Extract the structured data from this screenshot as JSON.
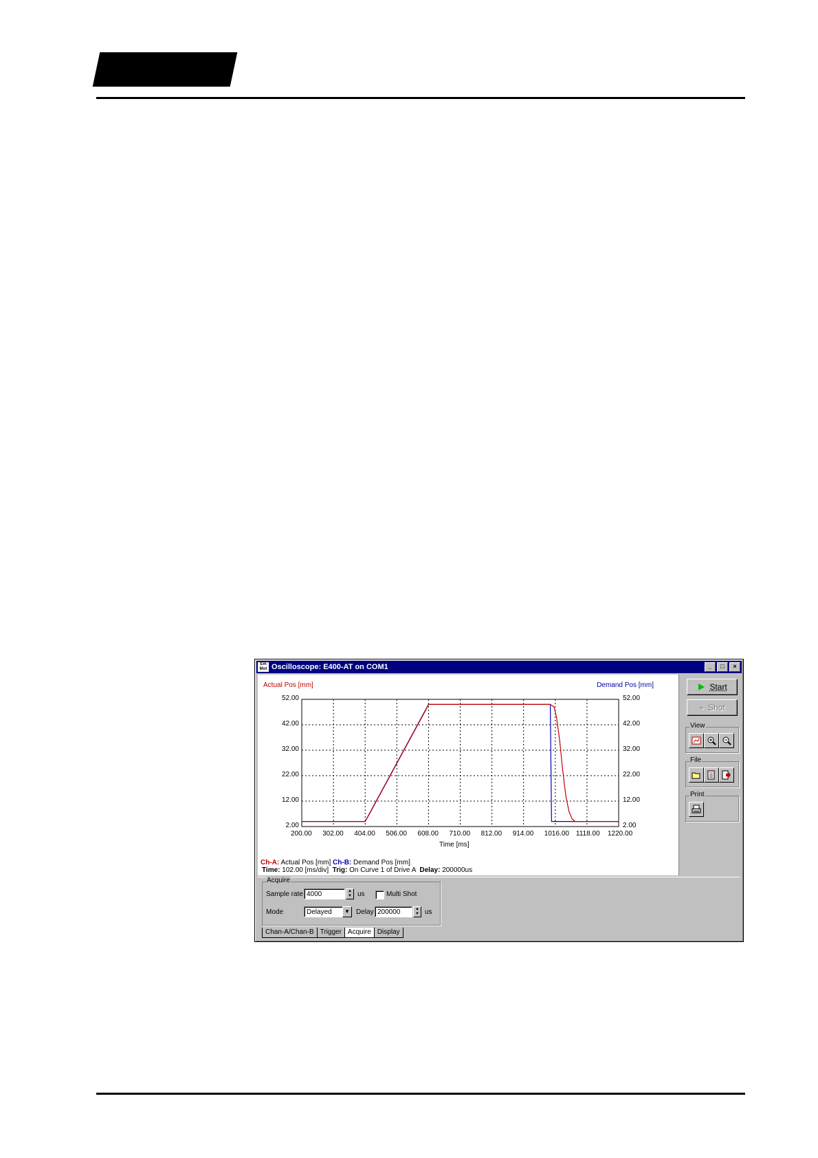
{
  "window": {
    "icon_text": "Em Mot",
    "title": "Oscilloscope: E400-AT on COM1",
    "min": "_",
    "max": "□",
    "close": "×"
  },
  "sidebar": {
    "start_label": "Start",
    "shot_label": "Shot",
    "view_label": "View",
    "file_label": "File",
    "print_label": "Print"
  },
  "chart_info": {
    "cha_tag": "Ch-A:",
    "cha_desc": "Actual Pos [mm]",
    "chb_tag": "Ch-B:",
    "chb_desc": "Demand Pos [mm]",
    "time_tag": "Time:",
    "time_value": "102.00 [ms/div]",
    "trig_tag": "Trig:",
    "trig_value": "On Curve 1 of Drive A",
    "delay_tag": "Delay:",
    "delay_value": "200000us"
  },
  "acquire": {
    "group_label": "Acquire",
    "sample_rate_label": "Sample rate",
    "sample_rate_value": "4000",
    "sample_rate_unit": "us",
    "multi_shot_label": "Multi Shot",
    "mode_label": "Mode",
    "mode_value": "Delayed",
    "delay_label": "Delay",
    "delay_value": "200000",
    "delay_unit": "us"
  },
  "tabs": [
    "Chan-A/Chan-B",
    "Trigger",
    "Acquire",
    "Display"
  ],
  "colors": {
    "cha": "#c00000",
    "chb": "#0000c0",
    "titlebar": "#000080"
  },
  "chart_data": {
    "type": "line",
    "xlabel": "Time [ms]",
    "ylabel_left": "Actual Pos [mm]",
    "ylabel_right": "Demand Pos [mm]",
    "xlim": [
      200,
      1220
    ],
    "ylim": [
      2,
      52
    ],
    "x_ticks": [
      "200.00",
      "302.00",
      "404.00",
      "506.00",
      "608.00",
      "710.00",
      "812.00",
      "914.00",
      "1016.00",
      "1118.00",
      "1220.00"
    ],
    "y_ticks": [
      "52.00",
      "42.00",
      "32.00",
      "22.00",
      "12.00",
      "2.00"
    ],
    "grid": true,
    "series": [
      {
        "name": "Actual Pos [mm]",
        "color": "#c00000",
        "x": [
          200,
          404,
          415,
          600,
          608,
          1000,
          1012,
          1020,
          1030,
          1040,
          1050,
          1060,
          1070,
          1080,
          1220
        ],
        "y": [
          4,
          4,
          6.3,
          48,
          50,
          50,
          49,
          45,
          36,
          24,
          14,
          8,
          5,
          4,
          4
        ]
      },
      {
        "name": "Demand Pos [mm]",
        "color": "#0000c0",
        "x": [
          200,
          404,
          608,
          1000,
          1004,
          1220
        ],
        "y": [
          4,
          4,
          50,
          50,
          4,
          4
        ]
      }
    ]
  }
}
